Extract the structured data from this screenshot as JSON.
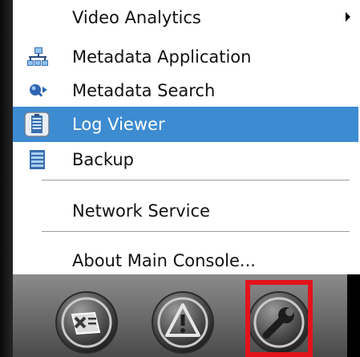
{
  "menu": {
    "items": [
      {
        "label": "Video Analytics",
        "icon": "none",
        "has_submenu": true
      },
      {
        "label": "Metadata Application",
        "icon": "metadata-application-icon"
      },
      {
        "label": "Metadata Search",
        "icon": "metadata-search-icon"
      },
      {
        "label": "Log Viewer",
        "icon": "log-viewer-icon",
        "highlighted": true
      },
      {
        "label": "Backup",
        "icon": "backup-icon"
      },
      {
        "label": "Network Service",
        "icon": "none"
      },
      {
        "label": "About Main Console...",
        "icon": "none"
      }
    ]
  },
  "toolbar": {
    "buttons": [
      {
        "icon": "notes-icon"
      },
      {
        "icon": "warning-icon"
      },
      {
        "icon": "wrench-icon",
        "selected": true
      }
    ]
  },
  "colors": {
    "highlight": "#3d8bd1",
    "selection_border": "#e3131b"
  }
}
